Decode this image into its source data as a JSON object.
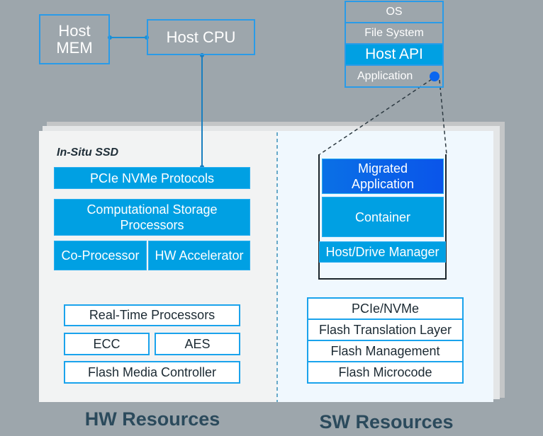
{
  "host": {
    "mem": "Host\nMEM",
    "cpu": "Host CPU"
  },
  "host_stack": [
    "OS",
    "File System",
    "Host API",
    "Application"
  ],
  "ssd": {
    "title": "In-Situ SSD",
    "hw": {
      "pcie": "PCIe NVMe Protocols",
      "csp": "Computational Storage Processors",
      "coproc": "Co-Processor",
      "hwacc": "HW Accelerator",
      "rtp": "Real-Time Processors",
      "ecc": "ECC",
      "aes": "AES",
      "fmc": "Flash Media Controller"
    },
    "sw": {
      "migrated": "Migrated Application",
      "container": "Container",
      "manager": "Host/Drive Manager",
      "stack": [
        "PCIe/NVMe",
        "Flash Translation Layer",
        "Flash Management",
        "Flash Microcode"
      ]
    }
  },
  "labels": {
    "hw": "HW Resources",
    "sw": "SW Resources"
  },
  "colors": {
    "accent": "#00a0e3",
    "migrated": "#0a5ce8",
    "background": "#9da6ac"
  }
}
